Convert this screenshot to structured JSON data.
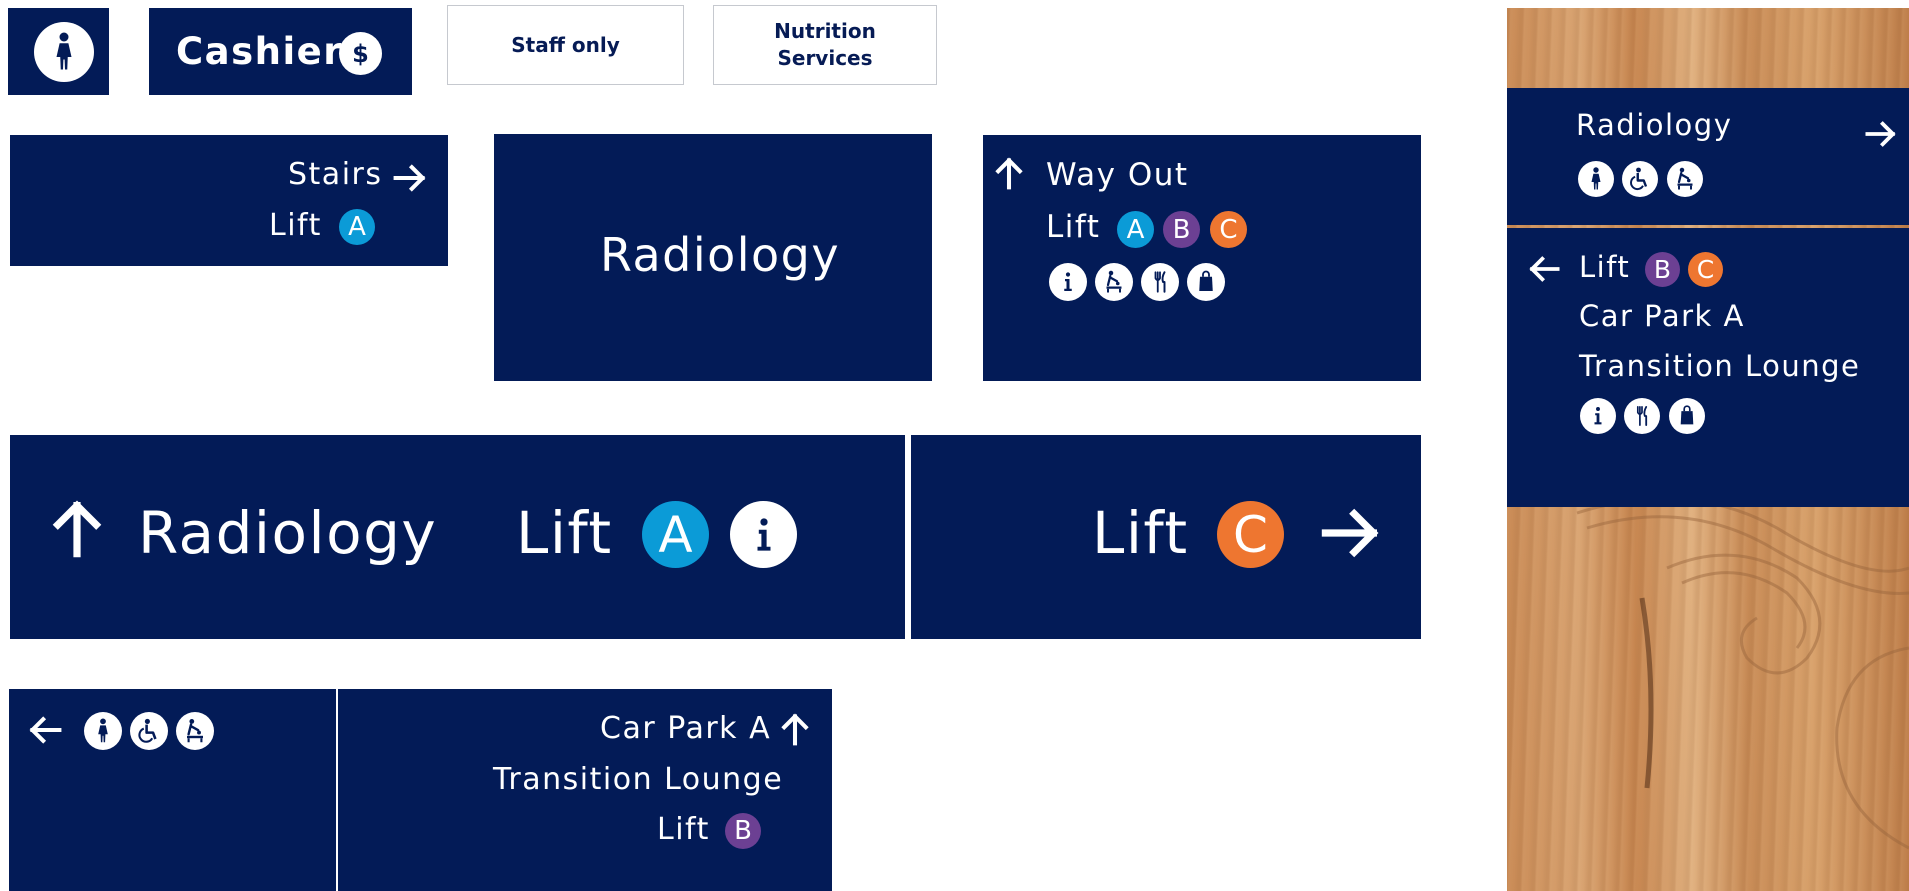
{
  "colors": {
    "navy": "#031b57",
    "lift_a": "#0b9bd7",
    "lift_b": "#6c4093",
    "lift_c": "#ee7630",
    "white": "#ffffff"
  },
  "sign_toilet": {
    "icon": "female-toilet-icon"
  },
  "sign_cashier": {
    "label": "Cashier",
    "icon_glyph": "$"
  },
  "sign_staff": {
    "label": "Staff only"
  },
  "sign_nutrition": {
    "line1": "Nutrition",
    "line2": "Services"
  },
  "sign_stairs": {
    "stairs": "Stairs",
    "lift": "Lift",
    "lift_badge": "A"
  },
  "sign_radiology_center": {
    "label": "Radiology"
  },
  "sign_wayout": {
    "title": "Way Out",
    "lift": "Lift",
    "badges": [
      "A",
      "B",
      "C"
    ],
    "icons": [
      "info-icon",
      "baby-change-icon",
      "cafe-icon",
      "shop-icon"
    ]
  },
  "banner_left": {
    "label": "Radiology",
    "lift": "Lift",
    "lift_badge": "A",
    "info_glyph": "i"
  },
  "banner_right": {
    "lift": "Lift",
    "lift_badge": "C"
  },
  "sign_bottom_left": {
    "icons": [
      "female-toilet-icon",
      "accessible-icon",
      "baby-change-icon"
    ]
  },
  "sign_bottom_mid": {
    "line1": "Car Park A",
    "line2": "Transition Lounge",
    "lift": "Lift",
    "lift_badge": "B"
  },
  "wall_sign_top": {
    "label": "Radiology",
    "icons": [
      "female-toilet-icon",
      "accessible-icon",
      "baby-change-icon"
    ]
  },
  "wall_sign_bottom": {
    "lift": "Lift",
    "badges": [
      "B",
      "C"
    ],
    "line2": "Car Park A",
    "line3": "Transition Lounge",
    "icons": [
      "info-icon",
      "cafe-icon",
      "shop-icon"
    ]
  }
}
